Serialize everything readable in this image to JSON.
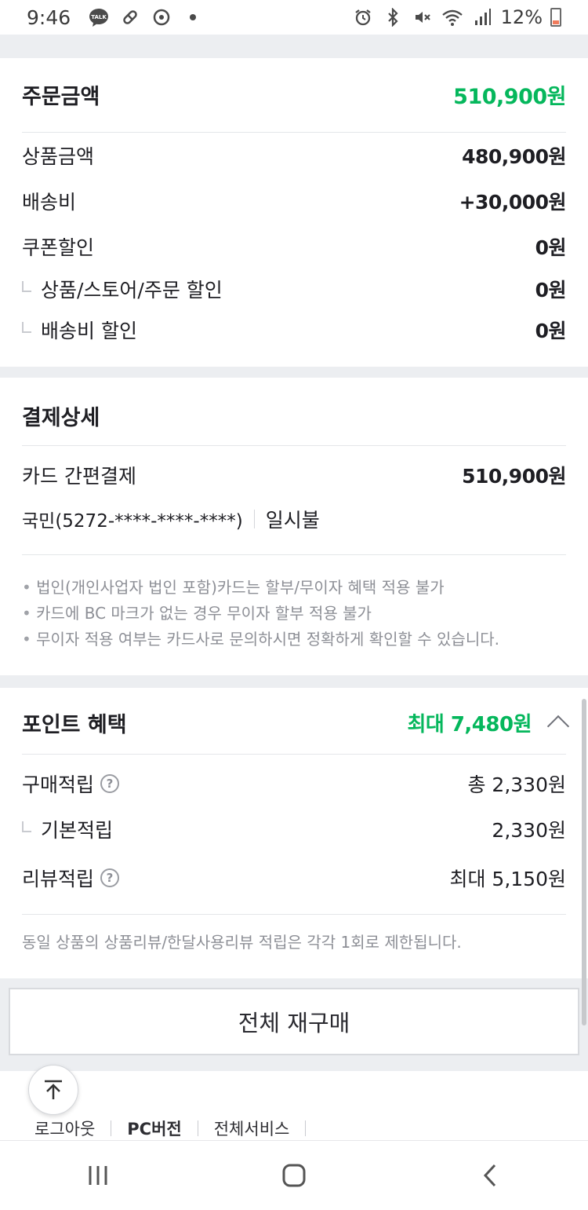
{
  "status_bar": {
    "time": "9:46",
    "battery": "12%"
  },
  "order_amount": {
    "title": "주문금액",
    "total": "510,900원",
    "rows": [
      {
        "label": "상품금액",
        "value": "480,900원"
      },
      {
        "label": "배송비",
        "value": "+30,000원"
      },
      {
        "label": "쿠폰할인",
        "value": "0원"
      },
      {
        "label": "상품/스토어/주문 할인",
        "value": "0원"
      },
      {
        "label": "배송비 할인",
        "value": "0원"
      }
    ]
  },
  "payment_detail": {
    "title": "결제상세",
    "method_label": "카드 간편결제",
    "method_value": "510,900원",
    "card_info": "국민(5272-****-****-****)",
    "installment": "일시불",
    "notes": [
      "법인(개인사업자 법인 포함)카드는 할부/무이자 혜택 적용 불가",
      "카드에 BC 마크가 없는 경우 무이자 할부 적용 불가",
      "무이자 적용 여부는 카드사로 문의하시면 정확하게 확인할 수 있습니다."
    ]
  },
  "point_benefit": {
    "title": "포인트 혜택",
    "max": "최대 7,480원",
    "rows": [
      {
        "label": "구매적립",
        "value": "총 2,330원"
      },
      {
        "label": "기본적립",
        "value": "2,330원"
      },
      {
        "label": "리뷰적립",
        "value": "최대 5,150원"
      }
    ],
    "note": "동일 상품의 상품리뷰/한달사용리뷰 적립은 각각 1회로 제한됩니다."
  },
  "rebuy_button": "전체 재구매",
  "footer": {
    "logout": "로그아웃",
    "pc_version": "PC버전",
    "all_services": "전체서비스"
  },
  "colors": {
    "accent_green": "#05b75c",
    "background": "#eceef1"
  }
}
